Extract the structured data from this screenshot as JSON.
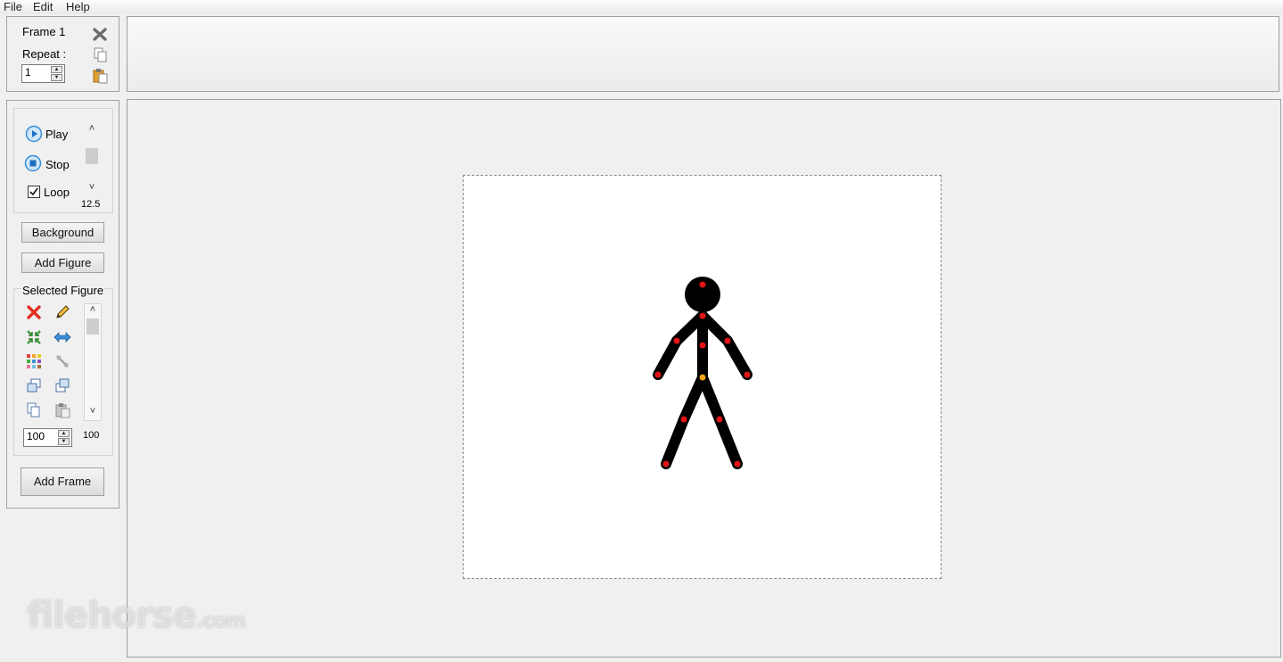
{
  "menu": {
    "file": "File",
    "edit": "Edit",
    "help": "Help"
  },
  "frame_panel": {
    "title": "Frame 1",
    "repeat_label": "Repeat :",
    "repeat_value": "1"
  },
  "playback": {
    "play_label": "Play",
    "stop_label": "Stop",
    "loop_label": "Loop",
    "loop_checked": true,
    "speed_value": "12.5"
  },
  "buttons": {
    "background": "Background",
    "add_figure": "Add Figure",
    "add_frame": "Add Frame"
  },
  "selected_figure": {
    "title": "Selected Figure",
    "size_value": "100",
    "opacity_value": "100",
    "tools": [
      "delete-icon",
      "edit-icon",
      "scale-icon",
      "flip-icon",
      "color-icon",
      "pin-icon",
      "bring-forward-icon",
      "send-backward-icon",
      "copy-icon",
      "paste-icon"
    ]
  },
  "colors": {
    "figure": "#000000",
    "joint": "#e31414",
    "origin_joint": "#f0a020",
    "canvas": "#ffffff"
  },
  "watermark": {
    "text": "filehorse",
    "suffix": ".com"
  }
}
